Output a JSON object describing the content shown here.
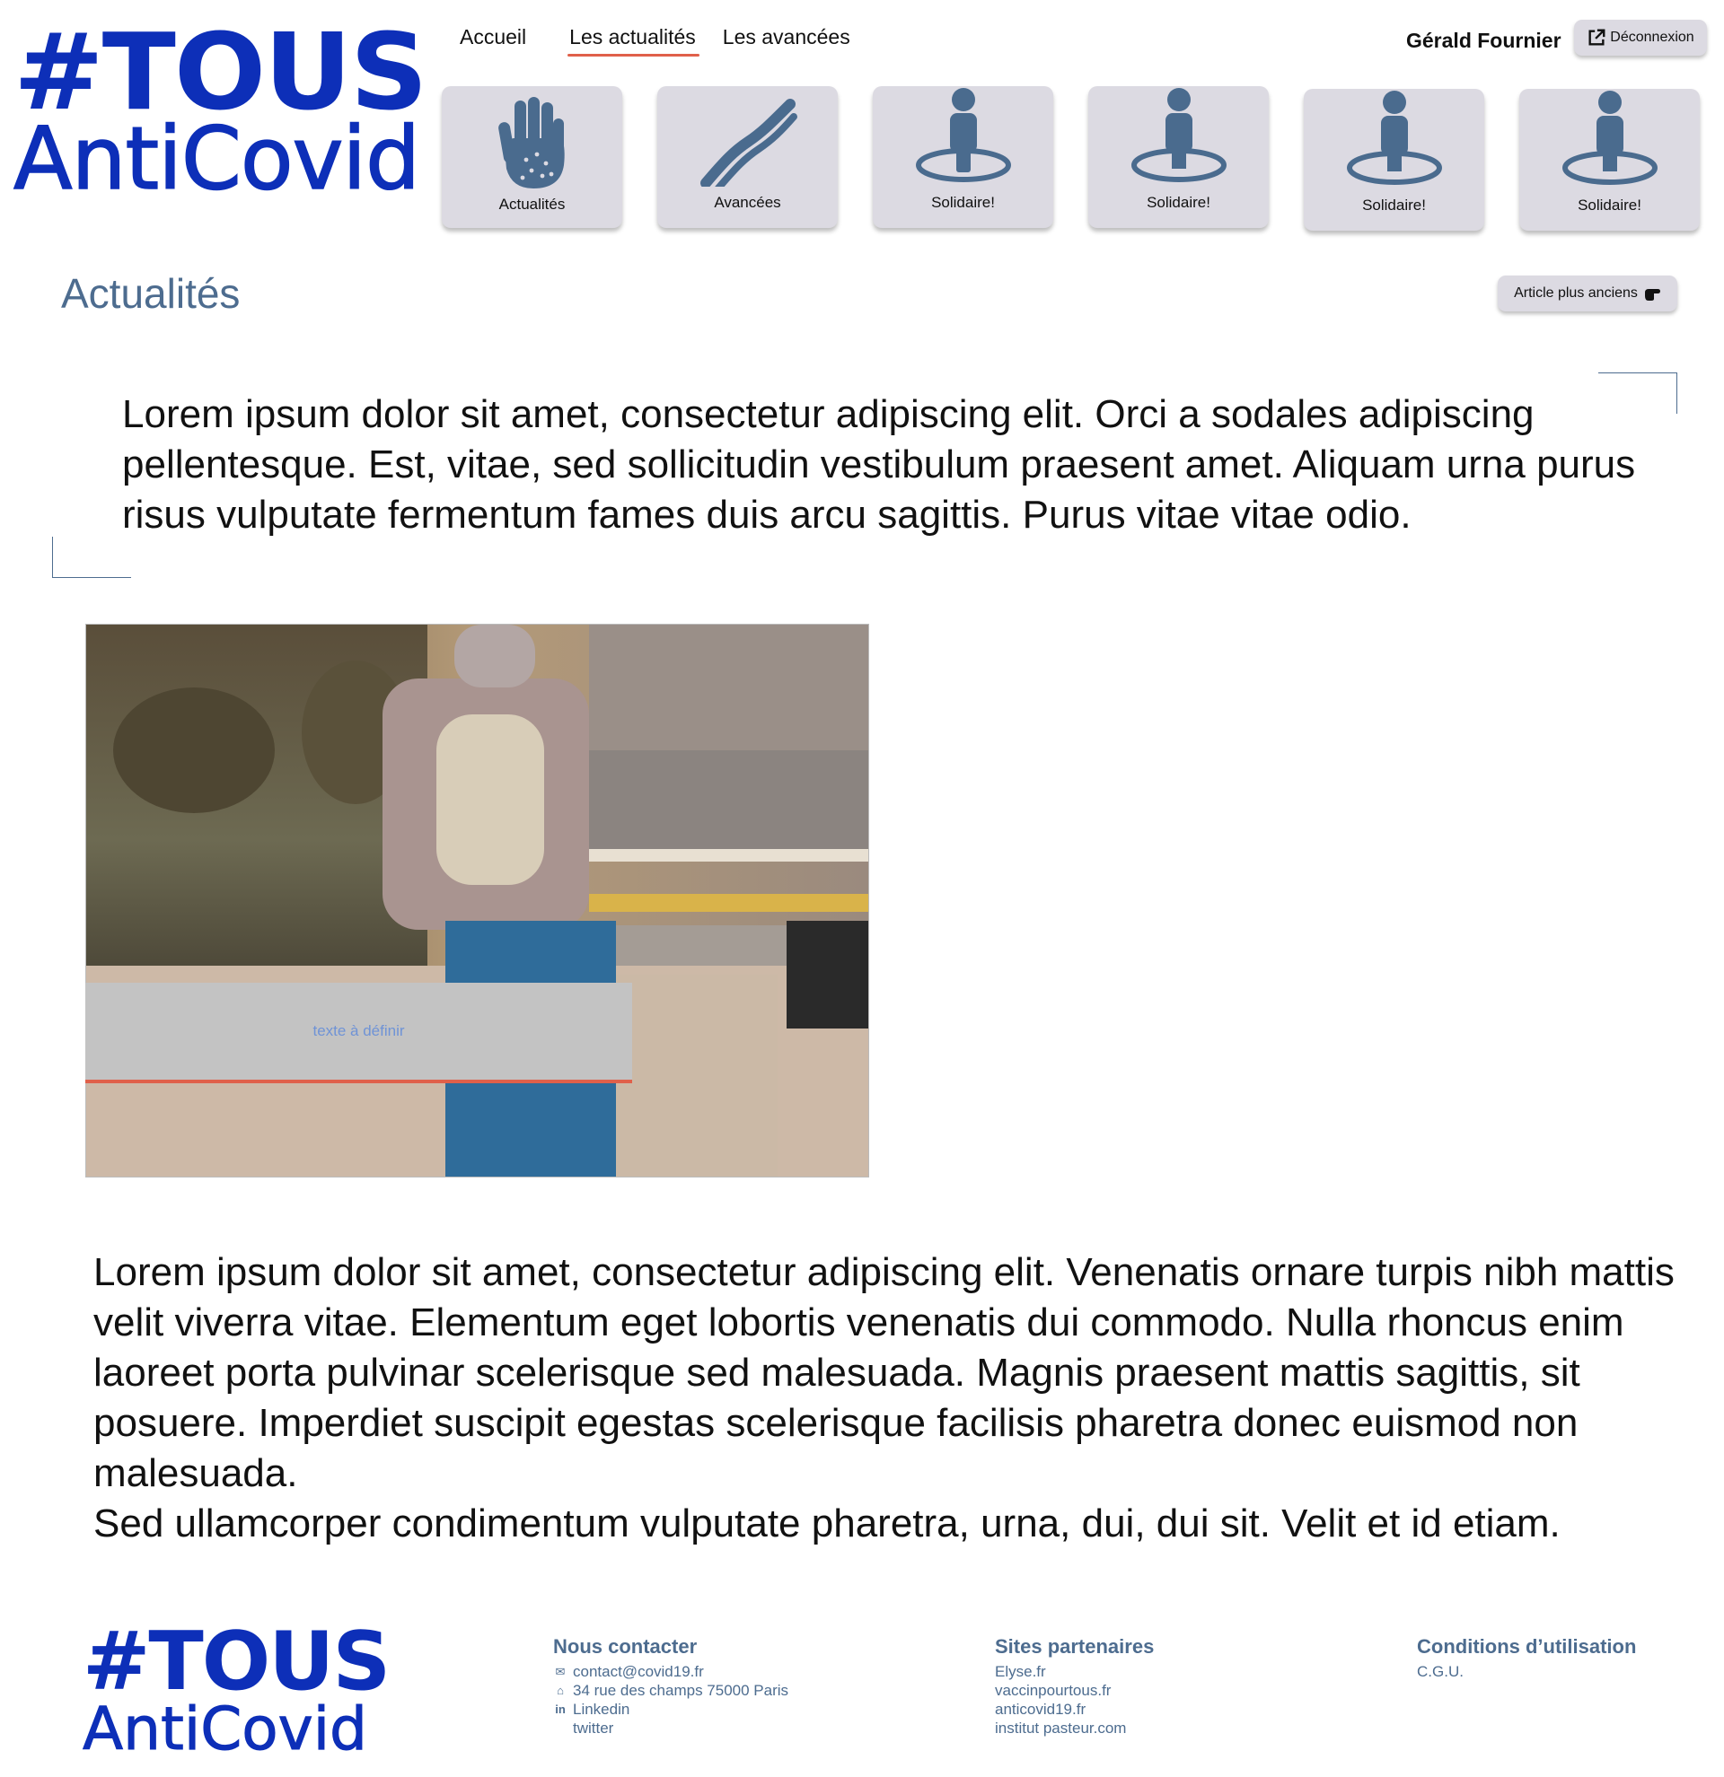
{
  "brand": {
    "logo_line1": "#TOUS",
    "logo_line2": "AntiCovid",
    "color": "#0d2fb8"
  },
  "nav": {
    "items": [
      {
        "label": "Accueil",
        "active": false
      },
      {
        "label": "Les actualités",
        "active": true
      },
      {
        "label": "Les avancées",
        "active": false
      }
    ]
  },
  "user": {
    "name": "Gérald Fournier",
    "logout_label": "Déconnexion"
  },
  "tiles": [
    {
      "label": "Actualités",
      "icon": "hand-icon"
    },
    {
      "label": "Avancées",
      "icon": "strand-icon"
    },
    {
      "label": "Solidaire!",
      "icon": "person-circle-icon"
    },
    {
      "label": "Solidaire!",
      "icon": "person-circle-icon"
    },
    {
      "label": "Solidaire!",
      "icon": "person-circle-icon"
    },
    {
      "label": "Solidaire!",
      "icon": "person-circle-icon"
    }
  ],
  "main": {
    "title": "Actualités",
    "older_button": "Article plus anciens",
    "intro": "Lorem ipsum dolor sit amet, consectetur adipiscing elit. Orci a sodales adipiscing pellentesque. Est, vitae, sed sollicitudin vestibulum praesent amet. Aliquam urna purus risus vulputate fermentum fames duis arcu sagittis. Purus vitae vitae odio.",
    "image_caption": "texte à définir",
    "body_p1": "Lorem ipsum dolor sit amet, consectetur adipiscing elit. Venenatis ornare turpis nibh mattis velit viverra vitae. Elementum eget lobortis venenatis dui commodo. Nulla rhoncus enim laoreet porta pulvinar scelerisque sed malesuada. Magnis praesent mattis sagittis, sit posuere. Imperdiet suscipit egestas scelerisque facilisis pharetra donec euismod non malesuada.",
    "body_p2": "Sed ullamcorper condimentum vulputate pharetra, urna, dui, dui sit. Velit et id etiam."
  },
  "footer": {
    "contact": {
      "title": "Nous contacter",
      "email": "contact@covid19.fr",
      "address": "34 rue des champs 75000 Paris",
      "linkedin": "Linkedin",
      "twitter": "twitter"
    },
    "partners": {
      "title": "Sites partenaires",
      "links": [
        "Elyse.fr",
        "vaccinpourtous.fr",
        "anticovid19.fr",
        "institut pasteur.com"
      ]
    },
    "terms": {
      "title": "Conditions d’utilisation",
      "link": "C.G.U."
    }
  },
  "colors": {
    "accent": "#e0604a",
    "muted_blue": "#4d6c8f",
    "tile_bg": "#dcdae2",
    "icon_blue": "#4a6b8e"
  }
}
